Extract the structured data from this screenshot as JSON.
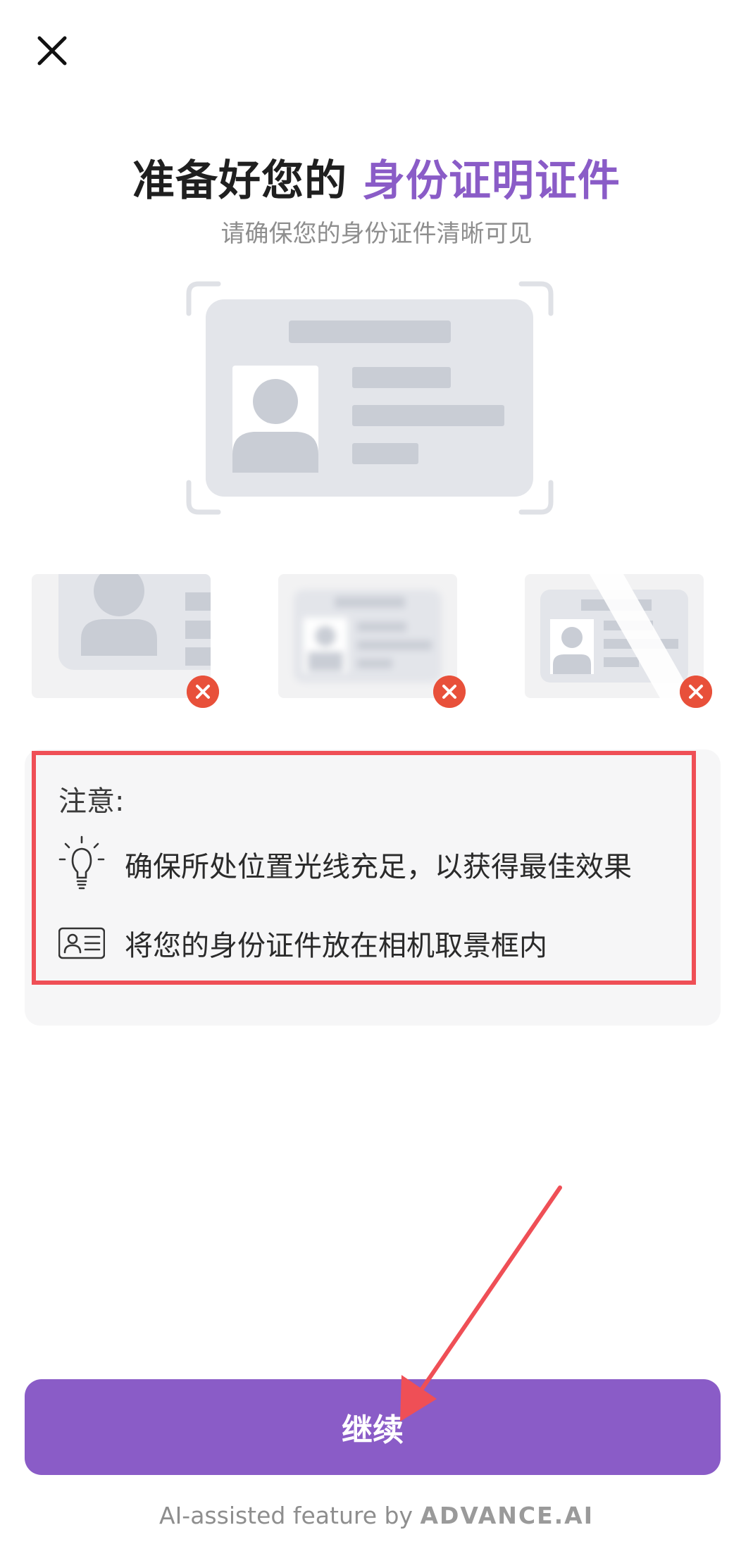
{
  "colors": {
    "accent": "#8a5cc7",
    "error": "#e8503a",
    "highlight_border": "#ef4f56",
    "placeholder_gray": "#cdd1d8"
  },
  "header": {
    "close_icon": "close-icon",
    "title_prefix": "准备好您的 ",
    "title_highlight": "身份证明证件",
    "subtitle": "请确保您的身份证件清晰可见"
  },
  "examples": [
    {
      "type": "cropped",
      "status_icon": "error-x-icon"
    },
    {
      "type": "blurry",
      "status_icon": "error-x-icon"
    },
    {
      "type": "glare",
      "status_icon": "error-x-icon"
    }
  ],
  "tips": {
    "heading": "注意:",
    "items": [
      {
        "icon": "lightbulb-icon",
        "text": "确保所处位置光线充足，以获得最佳效果"
      },
      {
        "icon": "id-card-icon",
        "text": "将您的身份证件放在相机取景框内"
      }
    ]
  },
  "footer": {
    "continue_label": "继续",
    "powered_prefix": "AI-assisted feature by ",
    "brand": "ADVANCE.AI"
  }
}
